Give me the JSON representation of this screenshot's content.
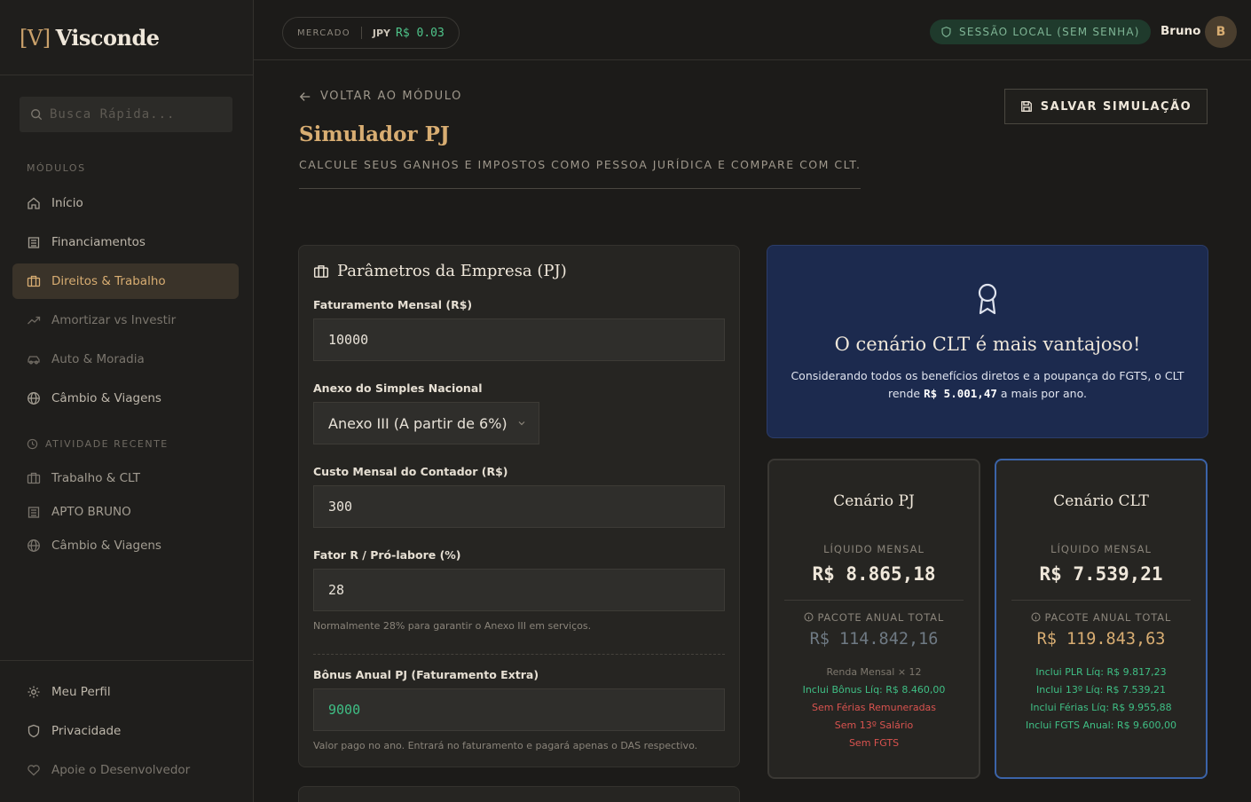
{
  "brand": {
    "mark": "[V]",
    "name": "Visconde"
  },
  "search": {
    "placeholder": "Busca Rápida..."
  },
  "sidebar": {
    "modules_label": "MÓDULOS",
    "items": [
      {
        "label": "Início"
      },
      {
        "label": "Financiamentos"
      },
      {
        "label": "Direitos & Trabalho"
      },
      {
        "label": "Amortizar vs Investir"
      },
      {
        "label": "Auto & Moradia"
      },
      {
        "label": "Câmbio & Viagens"
      }
    ],
    "recent_label": "ATIVIDADE RECENTE",
    "recent": [
      {
        "label": "Trabalho & CLT"
      },
      {
        "label": "APTO BRUNO"
      },
      {
        "label": "Câmbio & Viagens"
      }
    ],
    "footer": [
      {
        "label": "Meu Perfil"
      },
      {
        "label": "Privacidade"
      },
      {
        "label": "Apoie o Desenvolvedor"
      }
    ]
  },
  "topbar": {
    "market_label": "MERCADO",
    "currency": "JPY",
    "rate": "R$ 0.03",
    "session": "SESSÃO LOCAL (SEM SENHA)",
    "user": "Bruno",
    "avatar": "B"
  },
  "page": {
    "back": "VOLTAR AO MÓDULO",
    "title": "Simulador PJ",
    "subtitle": "CALCULE SEUS GANHOS E IMPOSTOS COMO PESSOA JURÍDICA E COMPARE COM CLT.",
    "save": "SALVAR SIMULAÇÃO"
  },
  "params": {
    "title": "Parâmetros da Empresa (PJ)",
    "revenue_label": "Faturamento Mensal (R$)",
    "revenue": "10000",
    "annex_label": "Anexo do Simples Nacional",
    "annex": "Anexo III (A partir de 6%)",
    "accountant_label": "Custo Mensal do Contador (R$)",
    "accountant": "300",
    "factor_label": "Fator R / Pró-labore (%)",
    "factor": "28",
    "factor_hint": "Normalmente 28% para garantir o Anexo III em serviços.",
    "bonus_label": "Bônus Anual PJ (Faturamento Extra)",
    "bonus": "9000",
    "bonus_hint": "Valor pago no ano. Entrará no faturamento e pagará apenas o DAS respectivo."
  },
  "winner": {
    "title": "O cenário CLT é mais vantajoso!",
    "text_before": "Considerando todos os benefícios diretos e a poupança do FGTS, o CLT rende",
    "amount": "R$ 5.001,47",
    "text_after": "a mais por ano."
  },
  "pj": {
    "title": "Cenário PJ",
    "net_label": "LÍQUIDO MENSAL",
    "net": "R$ 8.865,18",
    "pkg_label": "PACOTE ANUAL TOTAL",
    "pkg": "R$ 114.842,16",
    "lines": [
      "Renda Mensal × 12",
      "Inclui Bônus Líq: R$ 8.460,00",
      "Sem Férias Remuneradas",
      "Sem 13º Salário",
      "Sem FGTS"
    ]
  },
  "clt": {
    "title": "Cenário CLT",
    "net_label": "LÍQUIDO MENSAL",
    "net": "R$ 7.539,21",
    "pkg_label": "PACOTE ANUAL TOTAL",
    "pkg": "R$ 119.843,63",
    "lines": [
      "Inclui PLR Líq: R$ 9.817,23",
      "Inclui 13º Líq: R$ 7.539,21",
      "Inclui Férias Líq: R$ 9.955,88",
      "Inclui FGTS Anual: R$ 9.600,00"
    ]
  },
  "colors": {
    "accent": "#d8ad72",
    "positive": "#3fbf85",
    "negative": "#d9534f",
    "winner_bg": "#1c2a4e"
  }
}
